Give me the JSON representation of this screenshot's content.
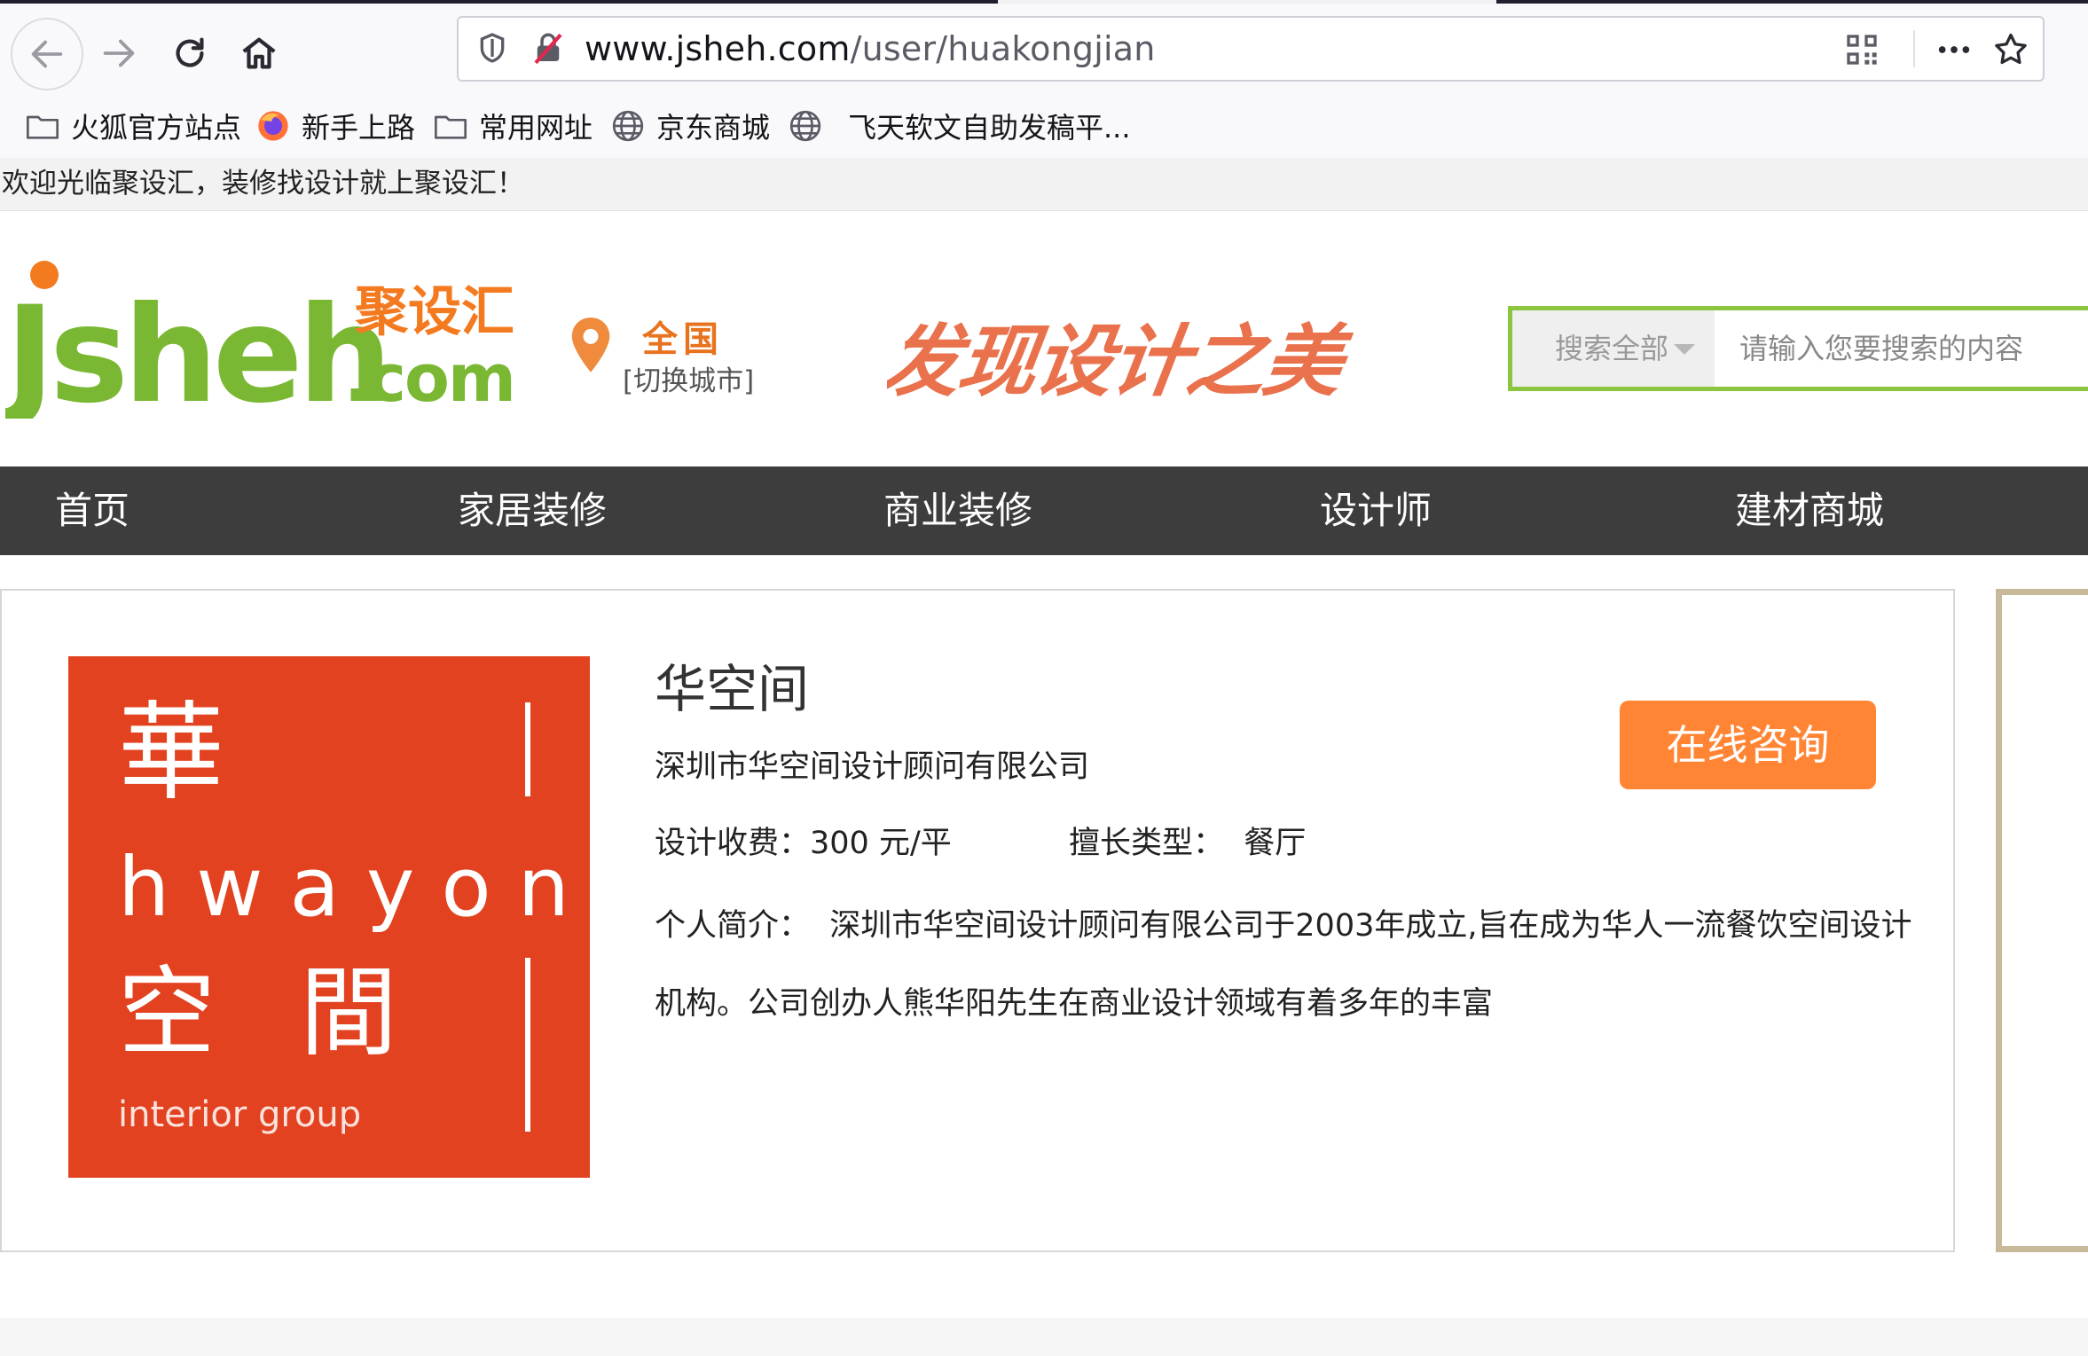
{
  "browser": {
    "url_host": "www.jsheh.com",
    "url_path": "/user/huakongjian",
    "bookmarks": [
      {
        "label": "火狐官方站点",
        "icon": "folder-icon"
      },
      {
        "label": "新手上路",
        "icon": "firefox-icon"
      },
      {
        "label": "常用网址",
        "icon": "folder-icon"
      },
      {
        "label": "京东商城",
        "icon": "globe-icon"
      },
      {
        "label": "飞天软文自助发稿平...",
        "icon": "globe-icon"
      }
    ]
  },
  "site": {
    "welcome": "欢迎光临聚设汇，装修找设计就上聚设汇！",
    "logo": {
      "brand": "Jsheh",
      "domain": ".com",
      "cn_name": "聚设汇"
    },
    "city": {
      "name": "全国",
      "switch": "[切换城市]"
    },
    "slogan": "发现设计之美",
    "search": {
      "scope": "搜索全部",
      "placeholder": "请输入您要搜索的内容"
    },
    "nav": [
      "首页",
      "家居装修",
      "商业装修",
      "设计师",
      "建材商城"
    ]
  },
  "profile": {
    "name": "华空间",
    "company": "深圳市华空间设计顾问有限公司",
    "fee_label": "设计收费：",
    "fee_value": "300 元/平",
    "specialty_label": "擅长类型：",
    "specialty_value": "餐厅",
    "bio_label": "个人简介：",
    "bio_text": "深圳市华空间设计顾问有限公司于2003年成立,旨在成为华人一流餐饮空间设计机构。公司创办人熊华阳先生在商业设计领域有着多年的丰富",
    "consult_button": "在线咨询",
    "avatar_logo": {
      "cn_top": "華",
      "latin": "hwayon",
      "cn_bottom": "空 間",
      "tagline": "interior group"
    }
  },
  "colors": {
    "accent_orange": "#ff8534",
    "brand_green": "#8cc63f",
    "nav_bg": "#3d3d3d",
    "avatar_red": "#e2421f"
  }
}
